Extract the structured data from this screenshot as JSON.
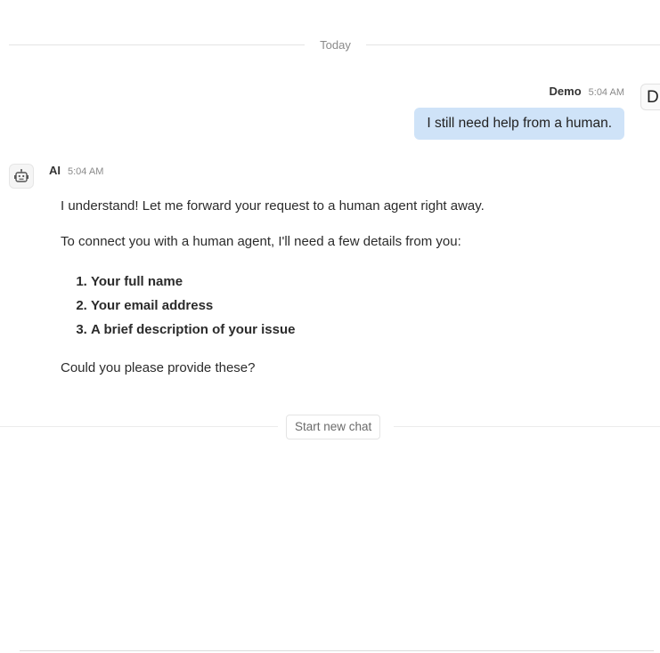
{
  "divider": {
    "today_label": "Today"
  },
  "user_message": {
    "sender": "Demo",
    "time": "5:04 AM",
    "avatar_letter": "D",
    "text": "I still need help from a human."
  },
  "ai_message": {
    "sender": "AI",
    "time": "5:04 AM",
    "avatar_icon": "robot-icon",
    "intro": "I understand! Let me forward your request to a human agent right away.",
    "details_request": "To connect you with a human agent, I'll need a few details from you:",
    "items": [
      "Your full name",
      "Your email address",
      "A brief description of your issue"
    ],
    "closing": "Could you please provide these?"
  },
  "new_chat": {
    "label": "Start new chat"
  }
}
